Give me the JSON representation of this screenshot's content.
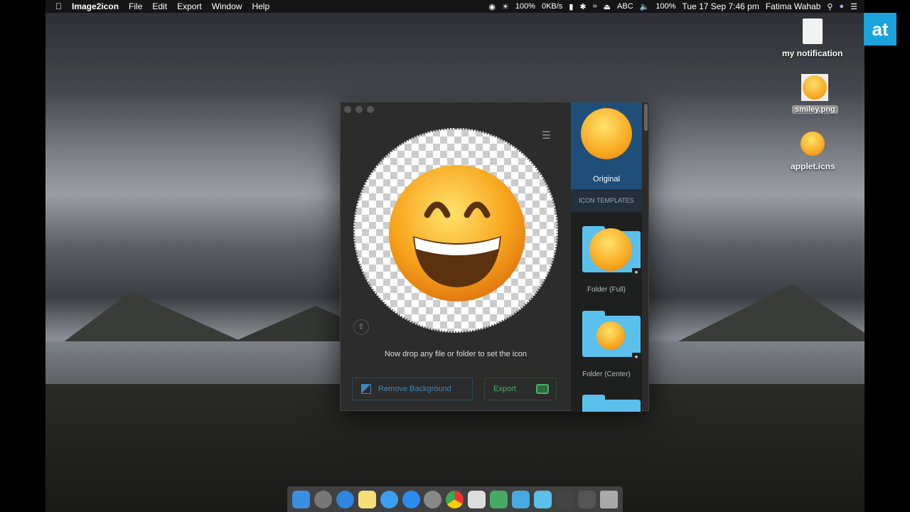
{
  "menubar": {
    "app_name": "Image2icon",
    "menus": [
      "File",
      "Edit",
      "Export",
      "Window",
      "Help"
    ],
    "status": {
      "brightness": "100%",
      "network": "0KB/s",
      "input": "ABC",
      "battery": "100%",
      "datetime": "Tue 17 Sep  7:46 pm",
      "user": "Fatima Wahab"
    }
  },
  "desktop": {
    "icons": [
      {
        "label": "my notification"
      },
      {
        "label": "smiley.png"
      },
      {
        "label": "applet.icns"
      }
    ],
    "watermark": "at"
  },
  "window": {
    "drop_hint": "Now drop any file or folder to set the icon",
    "remove_bg_label": "Remove Background",
    "export_label": "Export",
    "sidebar": {
      "original_label": "Original",
      "section_header": "ICON TEMPLATES",
      "templates": [
        {
          "label": "Folder (Full)",
          "locked": true
        },
        {
          "label": "Folder (Center)",
          "locked": true
        }
      ]
    }
  },
  "colors": {
    "remove_bg": "#3d86b8",
    "export": "#4caf6a",
    "selected": "#1f4f78",
    "watermark": "#1aa3dc"
  }
}
